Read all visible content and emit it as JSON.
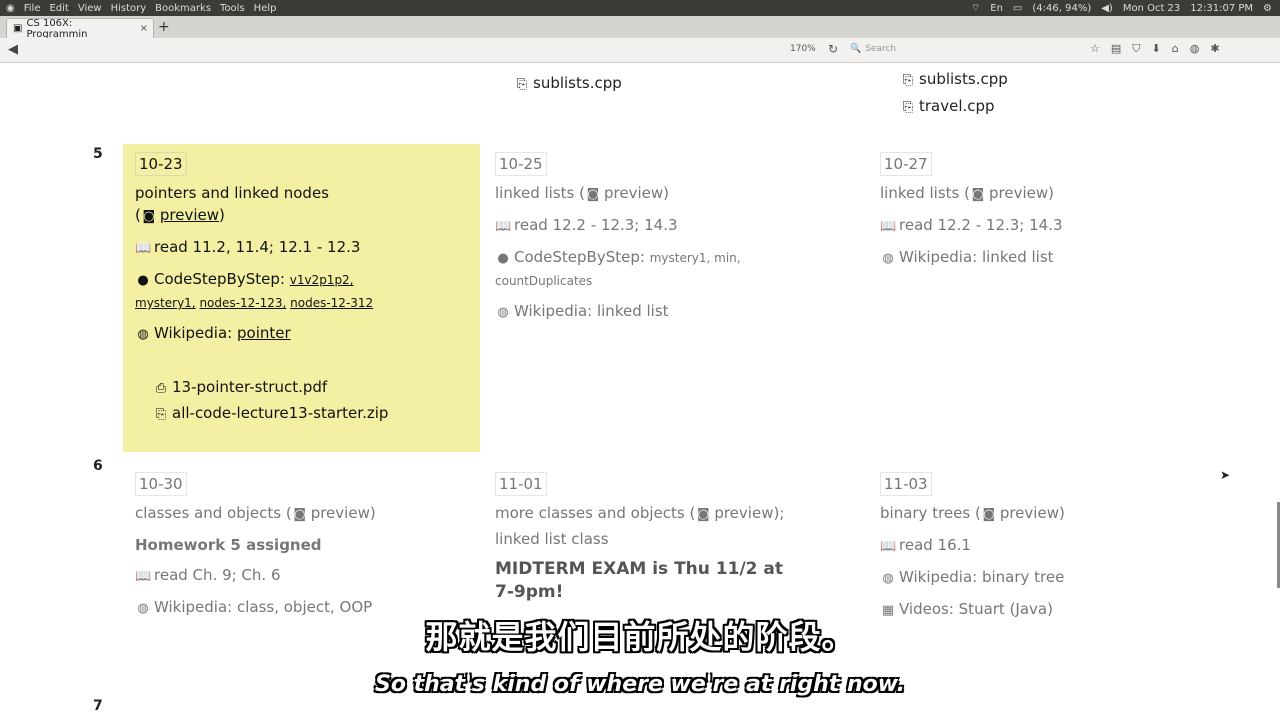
{
  "menubar": {
    "items": [
      "File",
      "Edit",
      "View",
      "History",
      "Bookmarks",
      "Tools",
      "Help"
    ],
    "system": {
      "lang": "En",
      "battery": "(4:46, 94%)",
      "date": "Mon Oct 23",
      "time": "12:31:07 PM"
    }
  },
  "tab": {
    "title": "CS 106X: Programmin",
    "close": "×",
    "new_tab": "+"
  },
  "navbar": {
    "zoom": "170%",
    "search_placeholder": "Search",
    "url": ""
  },
  "top_files": {
    "col2": [
      "sublists.cpp"
    ],
    "col3": [
      "sublists.cpp",
      "travel.cpp"
    ]
  },
  "week5": {
    "number": "5",
    "c1": {
      "date": "10-23",
      "title": "pointers and linked nodes",
      "preview": "preview",
      "read": "read 11.2, 11.4; 12.1 - 12.3",
      "codestep_label": "CodeStepByStep:",
      "codestep_links": [
        "v1v2p1p2,",
        "mystery1,",
        "nodes-12-123,",
        "nodes-12-312"
      ],
      "wiki_label": "Wikipedia:",
      "wiki_link": "pointer",
      "files": [
        "13-pointer-struct.pdf",
        "all-code-lecture13-starter.zip"
      ]
    },
    "c2": {
      "date": "10-25",
      "title": "linked lists",
      "preview": "preview",
      "read": "read 12.2 - 12.3; 14.3",
      "codestep_label": "CodeStepByStep:",
      "codestep_links": "mystery1, min,",
      "codestep_links2": "countDuplicates",
      "wiki": "Wikipedia: linked list"
    },
    "c3": {
      "date": "10-27",
      "title": "linked lists",
      "preview": "preview",
      "read": "read 12.2 - 12.3; 14.3",
      "wiki": "Wikipedia: linked list"
    }
  },
  "week6": {
    "number": "6",
    "c1": {
      "date": "10-30",
      "title": "classes and objects",
      "preview": "preview",
      "hw": "Homework 5 assigned",
      "read": "read Ch. 9; Ch. 6",
      "wiki": "Wikipedia: class, object, OOP"
    },
    "c2": {
      "date": "11-01",
      "title": "more classes and objects",
      "preview": "preview",
      "title2": "linked list class",
      "exam": "MIDTERM EXAM is Thu 11/2 at 7-9pm!"
    },
    "c3": {
      "date": "11-03",
      "title": "binary trees",
      "preview": "preview",
      "read": "read 16.1",
      "wiki": "Wikipedia: binary tree",
      "videos": "Videos: Stuart (Java)"
    }
  },
  "week7": {
    "number": "7"
  },
  "subtitles": {
    "zh": "那就是我们目前所处的阶段。",
    "en": "So that's kind of where we're at right now."
  }
}
